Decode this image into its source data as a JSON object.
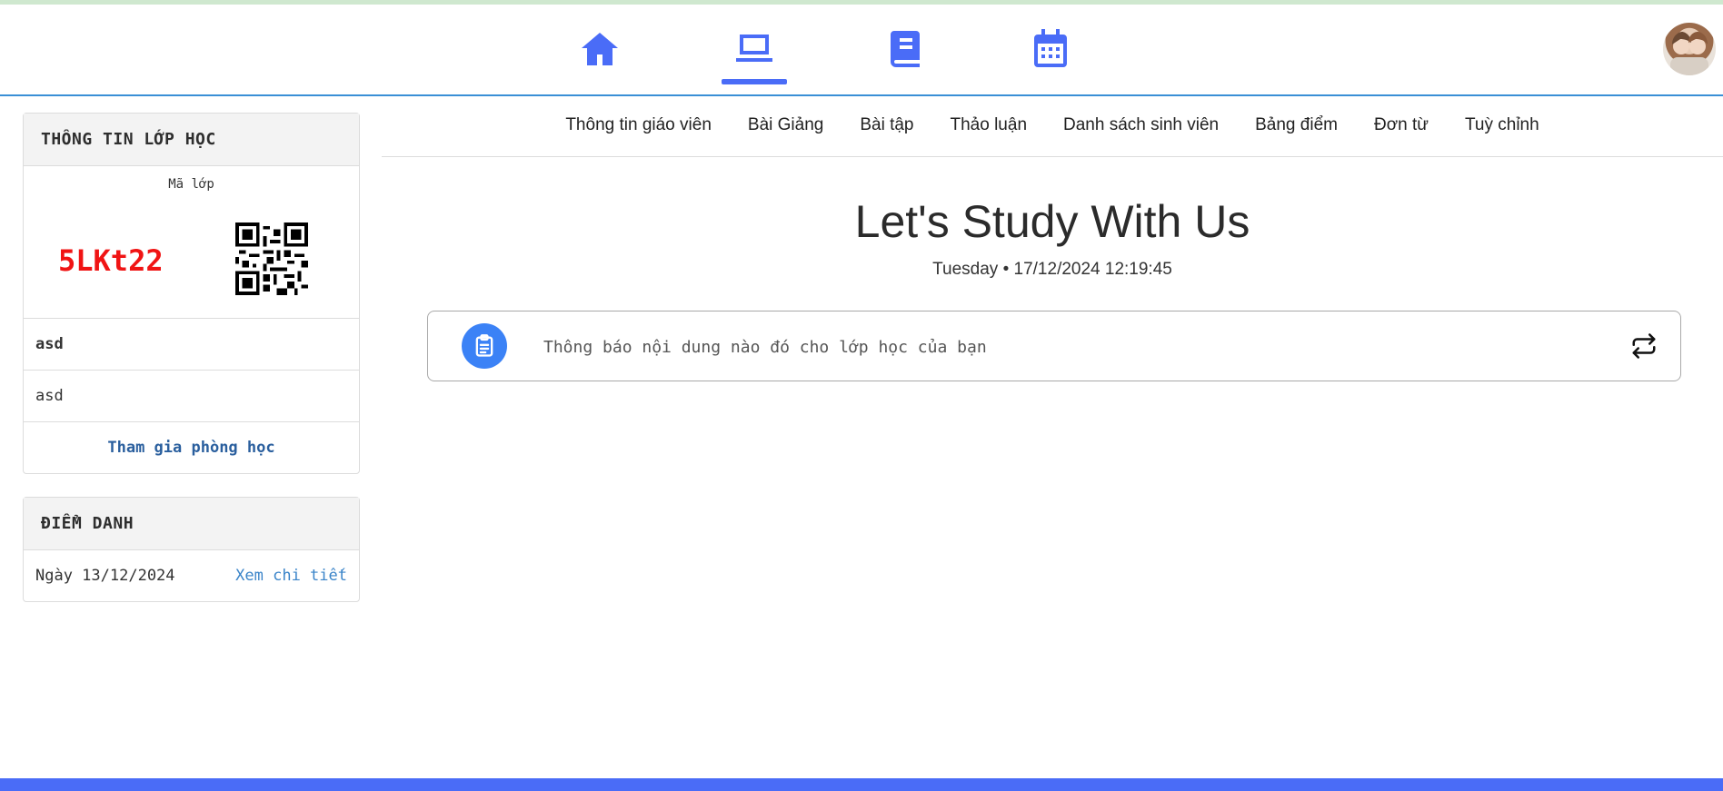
{
  "nav": {
    "icons": [
      "home-icon",
      "laptop-icon",
      "book-icon",
      "calendar-icon"
    ],
    "active": "laptop-icon",
    "accent": "#4a6cf7"
  },
  "class_info": {
    "heading": "THÔNG TIN LỚP HỌC",
    "code_label": "Mã lớp",
    "code": "5LKt22",
    "name": "asd",
    "description": "asd",
    "join_link": "Tham gia phòng học"
  },
  "attendance": {
    "heading": "ĐIỂM DANH",
    "date": "Ngày 13/12/2024",
    "detail_link": "Xem chi tiết"
  },
  "tabs": [
    "Thông tin giáo viên",
    "Bài Giảng",
    "Bài tập",
    "Thảo luận",
    "Danh sách sinh viên",
    "Bảng điểm",
    "Đơn từ",
    "Tuỳ chỉnh"
  ],
  "hero": {
    "title": "Let's Study With Us",
    "datetime": "Tuesday • 17/12/2024 12:19:45"
  },
  "announcement": {
    "placeholder": "Thông báo nội dung nào đó cho lớp học của bạn"
  },
  "colors": {
    "code": "#f01414",
    "link": "#2a5f9e",
    "footer": "#4a6cf7"
  }
}
